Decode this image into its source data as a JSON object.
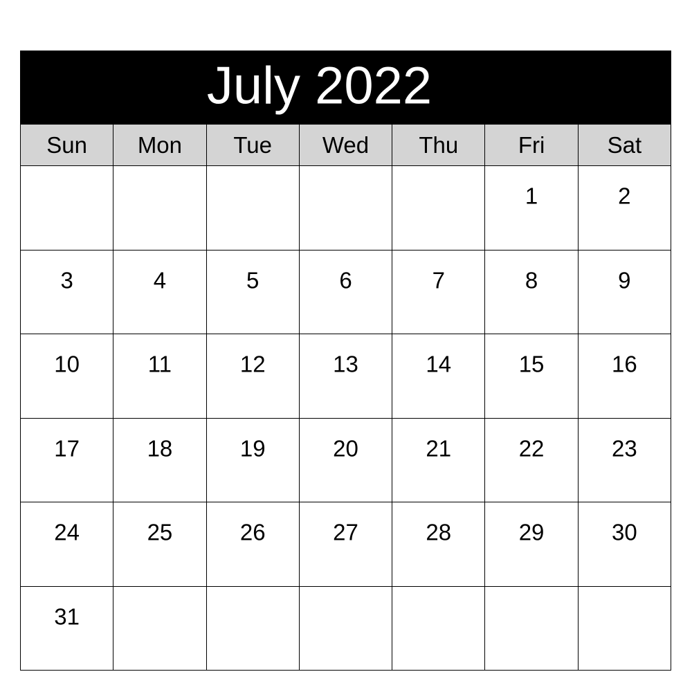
{
  "calendar": {
    "title": "July 2022",
    "month": "July",
    "year": "2022",
    "weekday_headers": [
      "Sun",
      "Mon",
      "Tue",
      "Wed",
      "Thu",
      "Fri",
      "Sat"
    ],
    "colors": {
      "title_band_background": "#000000",
      "title_text": "#ffffff",
      "weekday_header_background": "#d4d4d4",
      "day_cell_background": "#ffffff",
      "grid_line": "#000000",
      "day_text": "#000000"
    },
    "weeks": [
      [
        "",
        "",
        "",
        "",
        "",
        "1",
        "2"
      ],
      [
        "3",
        "4",
        "5",
        "6",
        "7",
        "8",
        "9"
      ],
      [
        "10",
        "11",
        "12",
        "13",
        "14",
        "15",
        "16"
      ],
      [
        "17",
        "18",
        "19",
        "20",
        "21",
        "22",
        "23"
      ],
      [
        "24",
        "25",
        "26",
        "27",
        "28",
        "29",
        "30"
      ],
      [
        "31",
        "",
        "",
        "",
        "",
        "",
        ""
      ]
    ]
  }
}
